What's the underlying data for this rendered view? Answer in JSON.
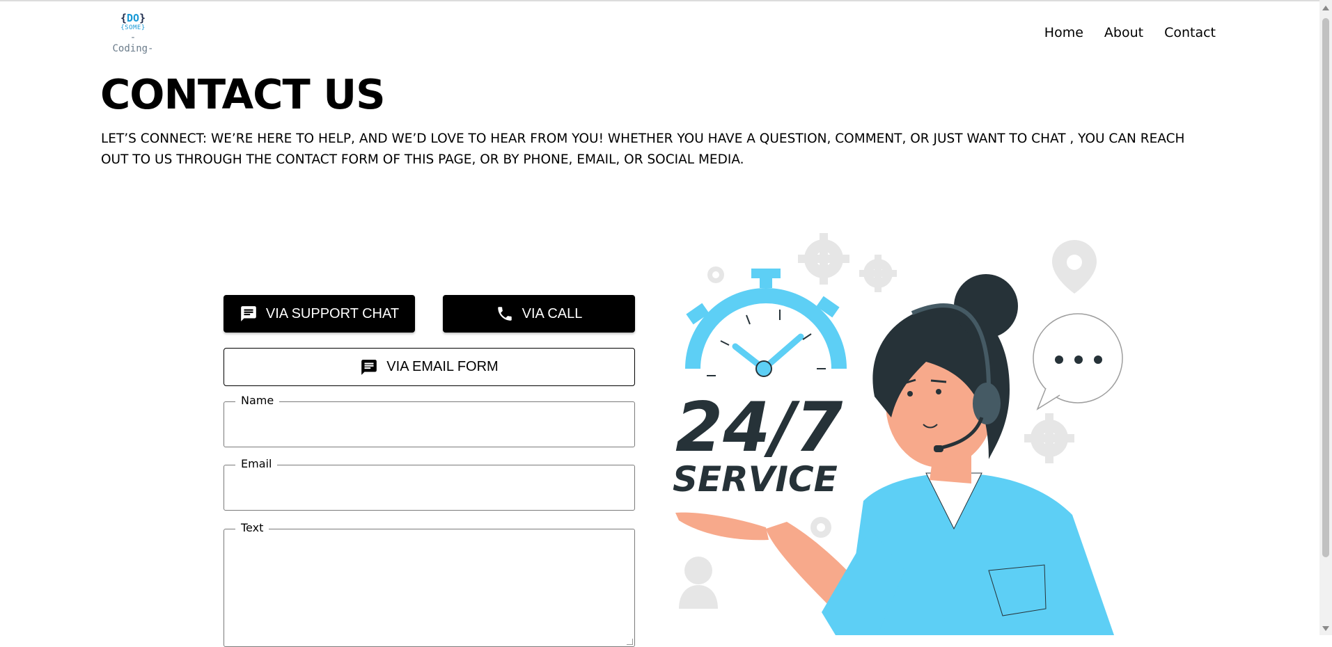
{
  "header": {
    "logo": {
      "line1_brace_open": "{",
      "line1": "DO",
      "line1_brace_close": "}",
      "line2": "{SOME}",
      "line3": "-Coding-"
    },
    "nav": [
      {
        "label": "Home"
      },
      {
        "label": "About"
      },
      {
        "label": "Contact"
      }
    ]
  },
  "page": {
    "title": "CONTACT US",
    "intro": "LET’S CONNECT: WE’RE HERE TO HELP, AND WE’D LOVE TO HEAR FROM YOU! WHETHER YOU HAVE A QUESTION, COMMENT, OR JUST WANT TO CHAT , YOU CAN REACH OUT TO US THROUGH THE CONTACT FORM OF THIS PAGE, OR BY PHONE, EMAIL, OR SOCIAL MEDIA."
  },
  "contact_options": {
    "support_chat": {
      "label": "VIA SUPPORT CHAT",
      "icon": "chat-icon"
    },
    "call": {
      "label": "VIA CALL",
      "icon": "phone-icon"
    },
    "email_form": {
      "label": "VIA EMAIL FORM",
      "icon": "chat-icon"
    }
  },
  "form": {
    "name": {
      "label": "Name",
      "value": ""
    },
    "email": {
      "label": "Email",
      "value": ""
    },
    "text": {
      "label": "Text",
      "value": ""
    }
  },
  "illustration": {
    "headline": "24/7",
    "subline": "SERVICE",
    "colors": {
      "accent": "#5dcff5",
      "dark": "#263238",
      "skin": "#f7a98b",
      "grey": "#e6e6e6"
    }
  }
}
